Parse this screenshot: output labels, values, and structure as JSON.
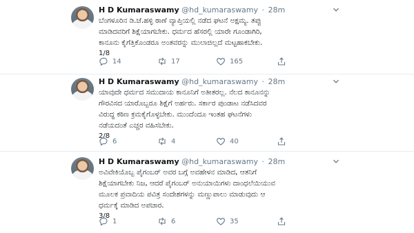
{
  "tweets": [
    {
      "name": "H D Kumaraswamy",
      "handle": "@hd_kumaraswamy",
      "separator": "·",
      "time": "28m",
      "lines": [
        "ಬೆಂಗಳೂರಿನ ಡಿ.ಜೆ.ಹಳ್ಳಿ ಠಾಣೆ ವ್ಯಾಪ್ತಿಯಲ್ಲಿ ನಡೆದ ಘಟನೆ ಅಕ್ಷಮ್ಯ. ತಪ್ಪು",
        "ಮಾಡಿದವರಿಗೆ ಶಿಕ್ಷೆಯಾಗಬೇಕು. ಧರ್ಮದ ಹೆಸರಲ್ಲಿ ಯಾರೇ ಗೂಂಡಾಗಿರಿ,",
        "ಕಾನೂನು ಕೈಗೆತ್ತಿಕೊಂಡರೂ ಅಂತವರನ್ನು ಮುಲಾಜಿಲ್ಲದೆ ಮಟ್ಟಹಾಕಬೇಕು."
      ],
      "counter": "1/8",
      "replies": "14",
      "retweets": "17",
      "likes": "165"
    },
    {
      "name": "H D Kumaraswamy",
      "handle": "@hd_kumaraswamy",
      "separator": "·",
      "time": "28m",
      "lines": [
        "ಯಾವುದೇ ಧರ್ಮದ ಸಮುದಾಯ ಕಾನೂನಿಗೆ ಅತೀತರಲ್ಲ. ನೆಲದ ಕಾನೂನನ್ನು",
        "ಗೌರವಿಸದ ಯಾರೊಬ್ಬರೂ ಶಿಕ್ಷೆಗೆ ಅರ್ಹರು. ಸರ್ಕಾರ ಪುಂಡಾಟ ನಡೆಸಿದವರ",
        "ವಿರುದ್ಧ ಕಠಿಣ ಕ್ರಮಕೈಗೊಳ್ಳಬೇಕು. ಮುಂದೆಂದೂ ಇಂತಹ ಘಟನೆಗಳು",
        "ನಡೆಯದಂತೆ ಎಚ್ಚರ ವಹಿಸಬೇಕು."
      ],
      "counter": "2/8",
      "replies": "6",
      "retweets": "4",
      "likes": "40"
    },
    {
      "name": "H D Kumaraswamy",
      "handle": "@hd_kumaraswamy",
      "separator": "·",
      "time": "28m",
      "lines": [
        "ಅವಿವೇಕಿಯೊಬ್ಬ ಪೈಗಂಬರ್ ಅವರ ಬಗ್ಗೆ ಅವಹೇಳನ ಮಾಡಿದ, ಆತನಿಗೆ",
        "ಶಿಕ್ಷೆಯಾಗಬೇಕು ನಿಜ, ಆದರೆ ಪೈಗಂಬರ್ ಅನುಯಾಯಿಗಳು ದಾಂಧಲೆಯಿಯುವ",
        "ಮೂಲಕ ಪ್ರವಾದಿಯ ಪವಿತ್ರ ಸಂದೇಶಗಳನ್ನು ಮಣ್ಣುಪಾಲು ಮಾಡುವುದು ಆ",
        "ಧರ್ಮಕ್ಕೆ ಮಾಡಿದ ಅಪಚಾರ."
      ],
      "counter": "3/8",
      "replies": "1",
      "retweets": "6",
      "likes": "35"
    }
  ],
  "icons": {
    "reply": "reply-icon",
    "retweet": "retweet-icon",
    "like": "heart-icon",
    "share": "share-icon",
    "menu": "chevron-down-icon"
  },
  "colors": {
    "text": "#14171a",
    "muted": "#657786",
    "border": "#e6ecf0"
  }
}
